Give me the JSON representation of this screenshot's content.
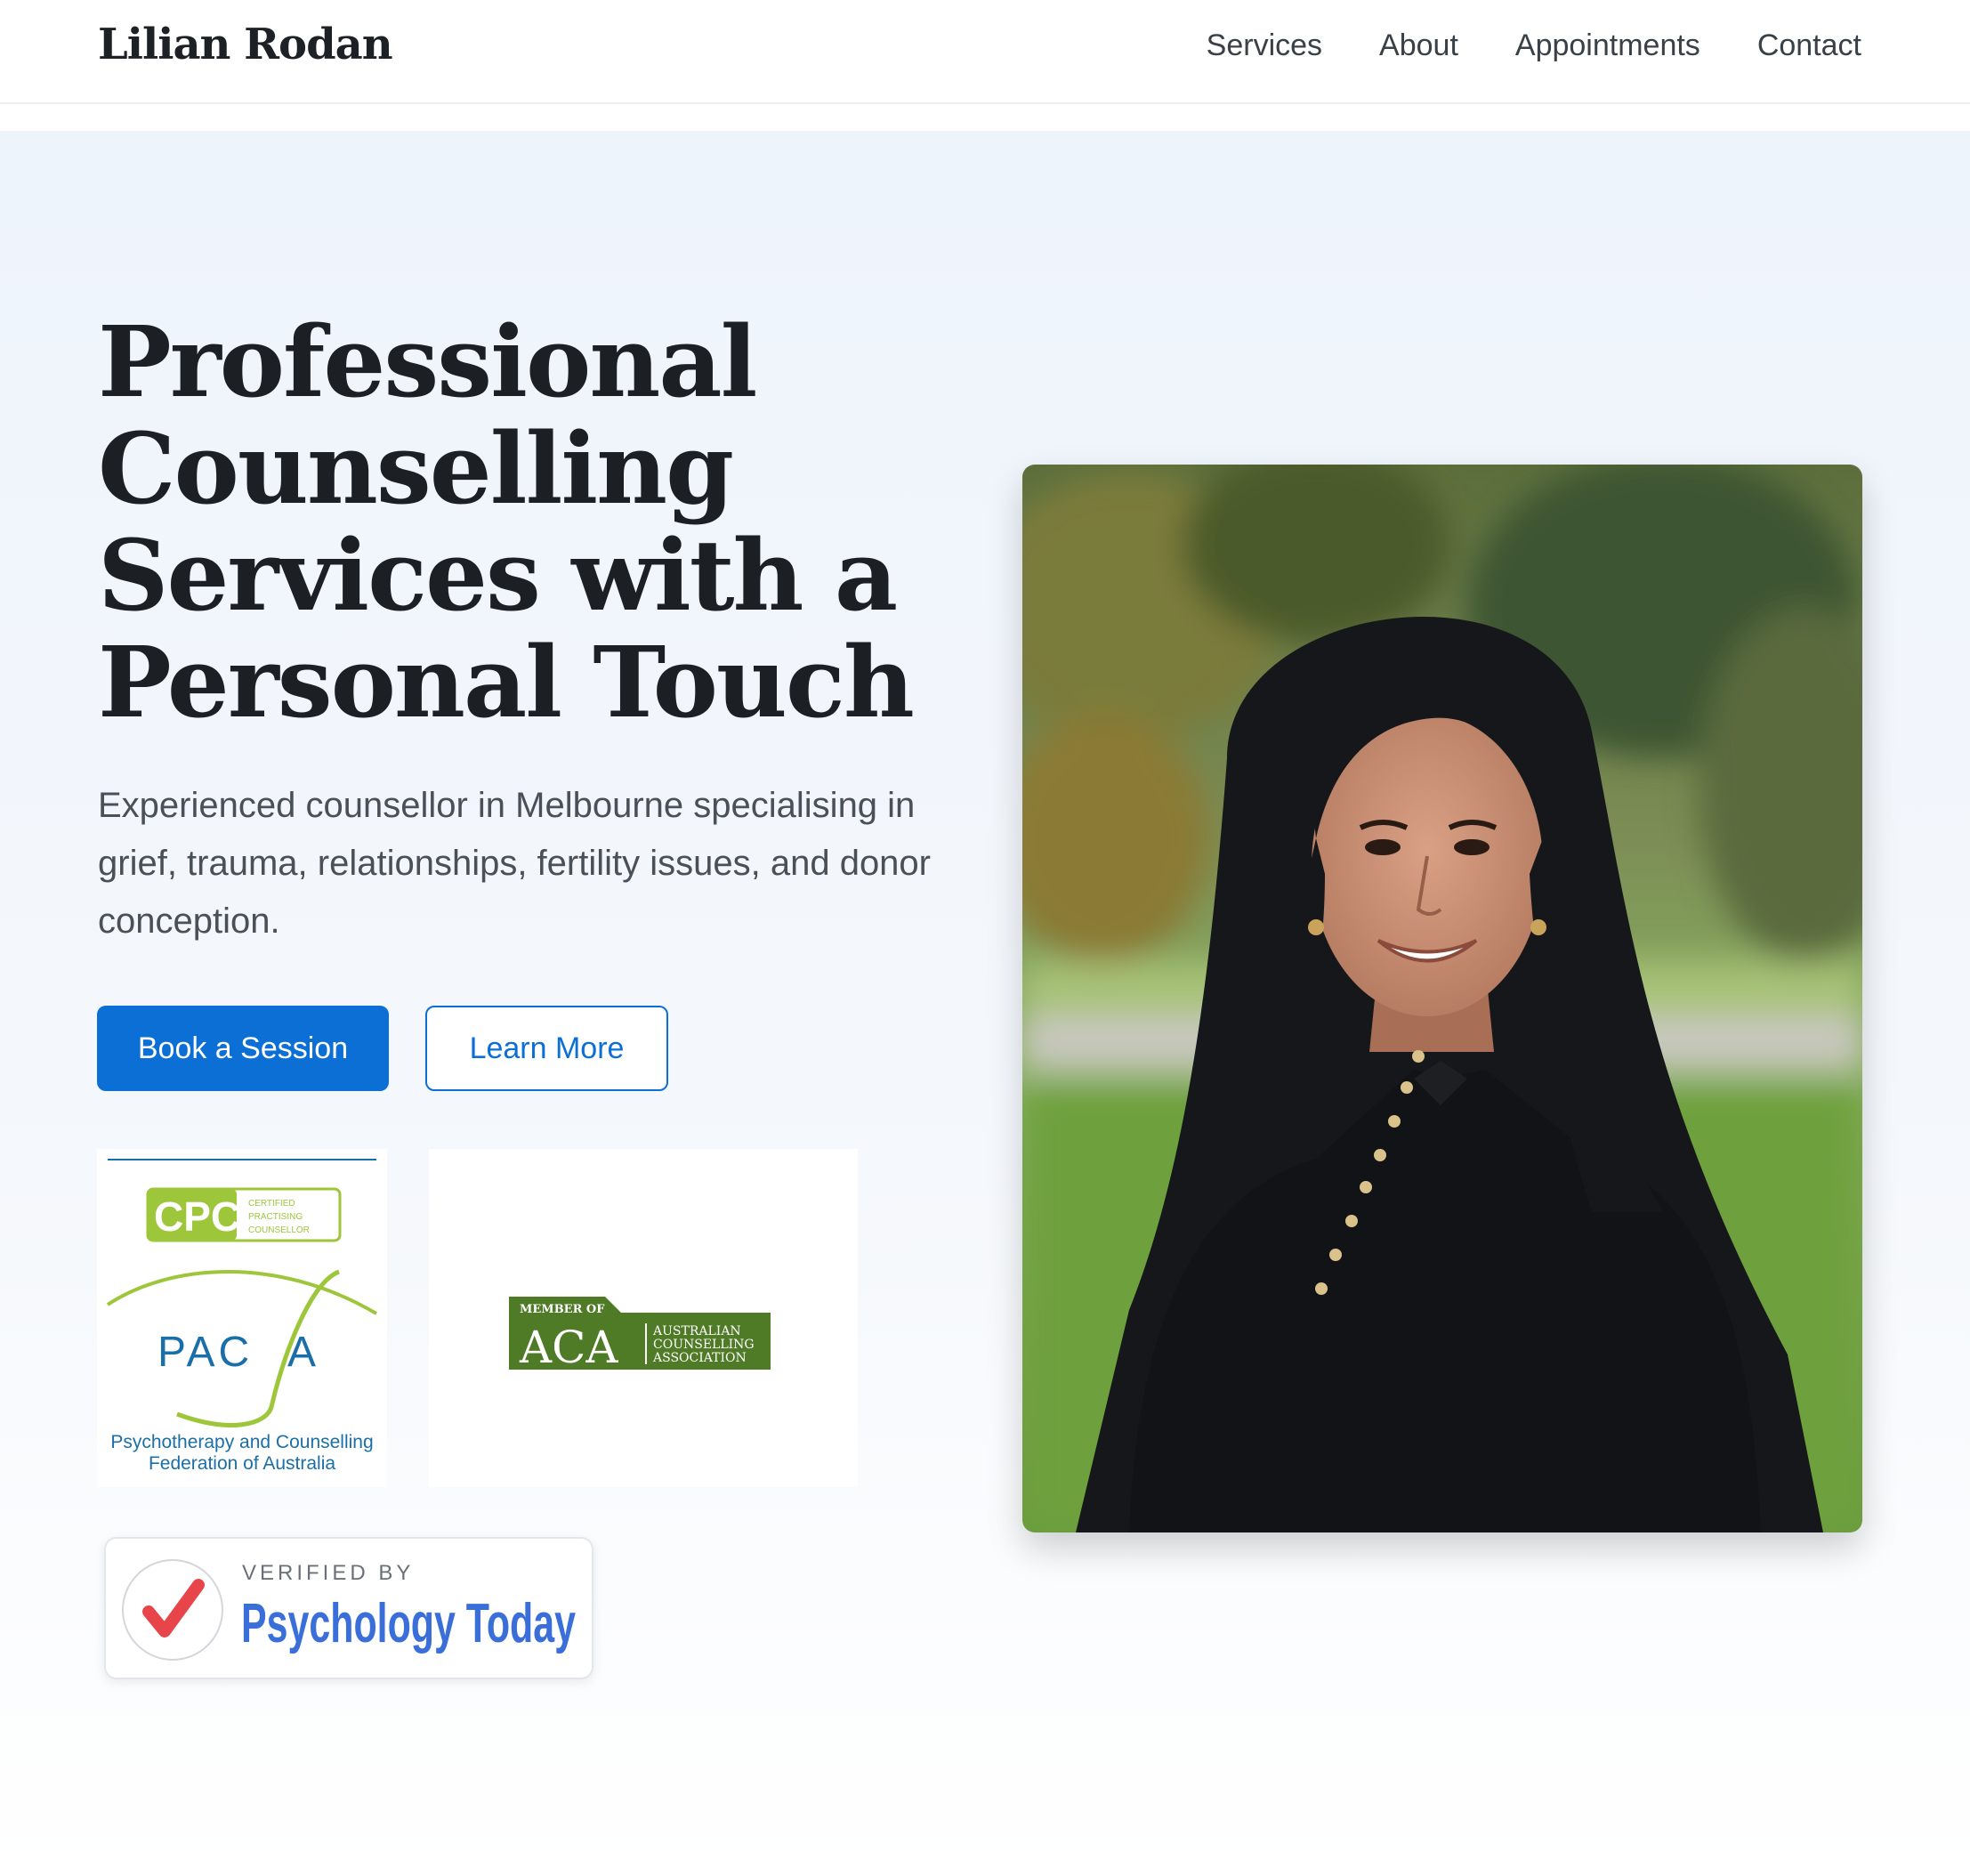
{
  "header": {
    "brand": "Lilian Rodan",
    "nav": [
      "Services",
      "About",
      "Appointments",
      "Contact"
    ]
  },
  "hero": {
    "headline": "Professional Counselling Services with a Personal Touch",
    "lead": "Experienced counsellor in Melbourne specialising in grief, trauma, relationships, fertility issues, and donor conception.",
    "primary_button": "Book a Session",
    "secondary_button": "Learn More"
  },
  "badges": {
    "pacfa": {
      "cpc": "CPC",
      "cpc_sub": [
        "CERTIFIED",
        "PRACTISING",
        "COUNSELLOR"
      ],
      "pac": "PAC",
      "a": "A",
      "org": [
        "Psychotherapy and Counselling",
        "Federation of Australia"
      ]
    },
    "aca": {
      "member_of": "MEMBER OF",
      "acronym": "ACA",
      "org": [
        "AUSTRALIAN",
        "COUNSELLING",
        "ASSOCIATION"
      ]
    },
    "psychology_today": {
      "verified_by": "VERIFIED BY",
      "name": "Psychology Today"
    }
  },
  "colors": {
    "primary": "#0b6fd6",
    "heading": "#1c2024",
    "cpc_green": "#9dc63a",
    "aca_green": "#4f7a26",
    "pacfa_blue": "#1b6fa8",
    "pt_blue": "#3a6ed8",
    "pt_check": "#e8454a"
  },
  "icons": [
    "checkmark-icon"
  ],
  "photo": {
    "alt": "Portrait of Lilian Rodan"
  }
}
